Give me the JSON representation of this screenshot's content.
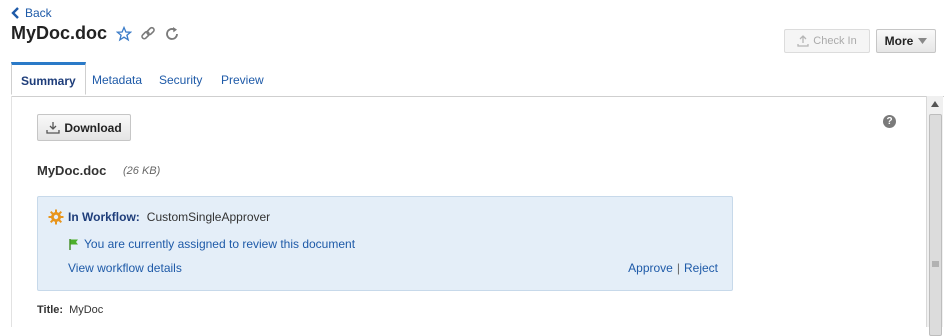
{
  "header": {
    "back_label": "Back",
    "title": "MyDoc.doc",
    "icons": [
      "star-icon",
      "link-icon",
      "refresh-icon"
    ],
    "checkin_label": "Check In",
    "more_label": "More"
  },
  "tabs": [
    {
      "label": "Summary",
      "active": true
    },
    {
      "label": "Metadata",
      "active": false
    },
    {
      "label": "Security",
      "active": false
    },
    {
      "label": "Preview",
      "active": false
    }
  ],
  "summary": {
    "download_label": "Download",
    "file_name": "MyDoc.doc",
    "file_size": "(26 KB)",
    "workflow": {
      "label": "In Workflow:",
      "name": "CustomSingleApprover",
      "assignment": "You are currently assigned to review this document",
      "details_link": "View workflow details",
      "approve_label": "Approve",
      "separator": "|",
      "reject_label": "Reject"
    },
    "fields": [
      {
        "label": "Title:",
        "value": "MyDoc"
      }
    ]
  },
  "colors": {
    "link": "#1e5aa8",
    "active_tab_border": "#2a7ac8",
    "workflow_bg": "#e4eef8",
    "workflow_icon": "#e8951c",
    "flag": "#4caf2a"
  }
}
